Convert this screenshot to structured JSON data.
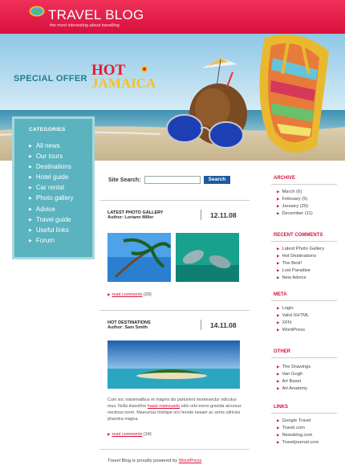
{
  "header": {
    "title": "TRAVEL BLOG",
    "tagline": "the most interesting about travelling",
    "brand_color": "#e01f48"
  },
  "hero": {
    "special_offer": "SPECIAL OFFER",
    "hot": "HOT",
    "jamaica": "JAMAICA"
  },
  "sidebar": {
    "title": "CATEGORIES",
    "items": [
      "All news",
      "Our tours",
      "Destinations",
      "Hotel guide",
      "Car rental",
      "Photo gallery",
      "Advice",
      "Travel guide",
      "Useful links",
      "Forum"
    ]
  },
  "search": {
    "label": "Site Search:",
    "value": "",
    "button": "Search"
  },
  "posts": [
    {
      "title": "LATEST PHOTO GALLERY",
      "author": "Author: Loriann Miller",
      "date": "12.11.08",
      "comments_link": "read comments",
      "comments_count": "(20)"
    },
    {
      "title": "HOT DESTINATIONS",
      "author": "Author: Sam Smith",
      "date": "14.11.08",
      "body_before": "Cum soc natoenatibus et magnis dis parturient montesectur ridiculus mus. Nulla duisothre ",
      "body_link": "hasat malesuada",
      "body_after": " odio orbi eores gravida atcursus nectious orem. Maecenas tristique orci ferode nesaer ac sems ultricies pharetra magna.",
      "comments_link": "read comments",
      "comments_count": "(14)"
    }
  ],
  "footer": {
    "text": "Travel Blog is proudly powered by ",
    "link": "WordPress"
  },
  "right": {
    "archive": {
      "title": "ARCHIVE",
      "items": [
        "March (6)",
        "February (5)",
        "January (20)",
        "December (11)"
      ]
    },
    "recent": {
      "title": "RECENT COMMENTS",
      "items": [
        "Latest Photo Gallery",
        "Hot Destinations",
        "The Best!",
        "Lost Paradise",
        "New Advice"
      ]
    },
    "meta": {
      "title": "META",
      "items": [
        "Login",
        "Valid XHTML",
        "XFN",
        "WordPress"
      ]
    },
    "other": {
      "title": "OTHER",
      "items": [
        "The Drawings",
        "Van Gogh",
        "Art Basel",
        "Art Anatomy"
      ]
    },
    "links": {
      "title": "LINKS",
      "items": [
        "Google Travel",
        "Travel.com",
        "Newsblog.com",
        "Traveljournal.com"
      ]
    }
  }
}
